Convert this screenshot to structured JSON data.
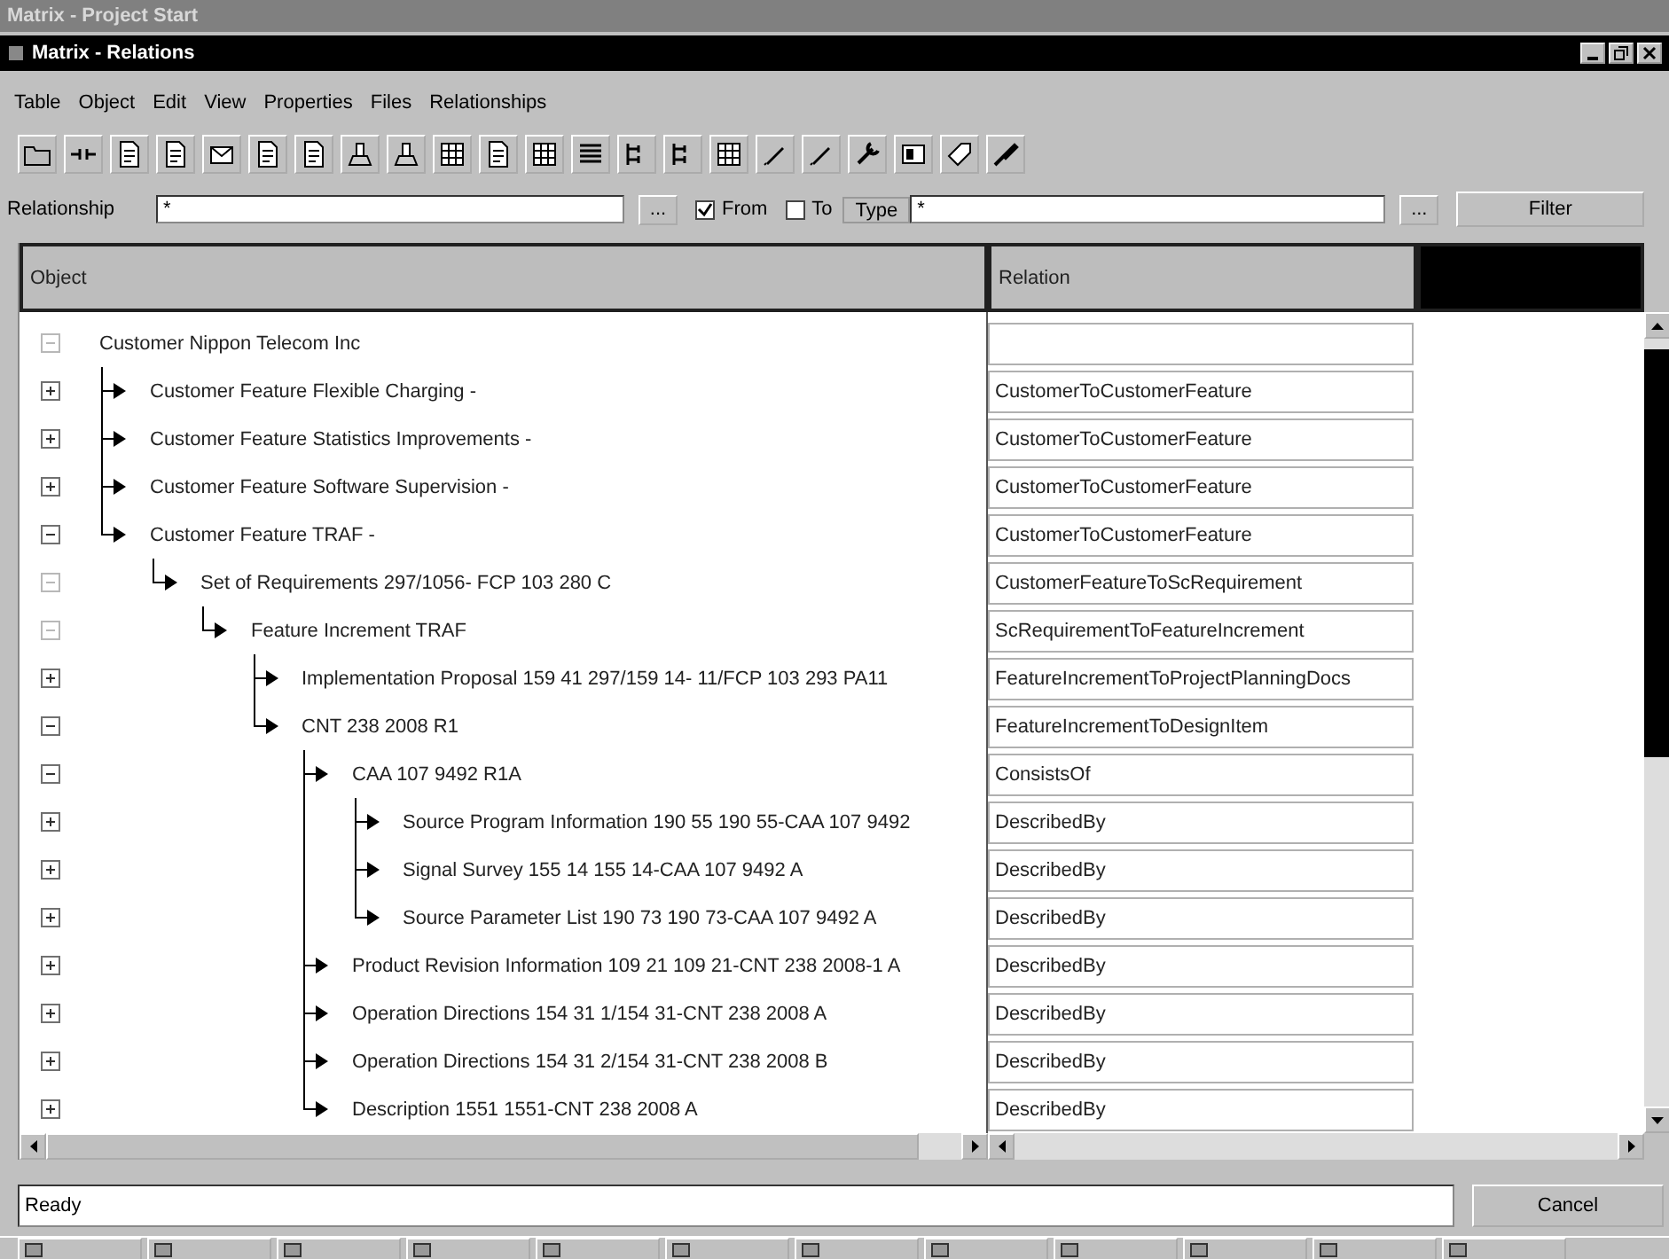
{
  "background_window": {
    "title": "Matrix - Project Start"
  },
  "window": {
    "title": "Matrix - Relations"
  },
  "menu": [
    "Table",
    "Object",
    "Edit",
    "View",
    "Properties",
    "Files",
    "Relationships"
  ],
  "filter": {
    "relationship_label": "Relationship",
    "relationship_value": "*",
    "browse_button": "...",
    "from": {
      "label": "From",
      "checked": true
    },
    "to": {
      "label": "To",
      "checked": false
    },
    "type_label": "Type",
    "type_value": "*",
    "type_browse_button": "...",
    "filter_button": "Filter"
  },
  "table": {
    "columns": [
      "Object",
      "Relation"
    ],
    "tree": [
      {
        "label": "Customer Nippon Telecom Inc",
        "expanded": true,
        "disabled": true,
        "children": [
          {
            "label": "Customer Feature Flexible Charging -",
            "relation": "CustomerToCustomerFeature",
            "expanded": false,
            "disabled": false
          },
          {
            "label": "Customer Feature Statistics Improvements -",
            "relation": "CustomerToCustomerFeature",
            "expanded": false,
            "disabled": false
          },
          {
            "label": "Customer Feature Software Supervision -",
            "relation": "CustomerToCustomerFeature",
            "expanded": false,
            "disabled": false
          },
          {
            "label": "Customer Feature TRAF -",
            "relation": "CustomerToCustomerFeature",
            "expanded": true,
            "disabled": false,
            "children": [
              {
                "label": "Set of Requirements 297/1056- FCP 103 280 C",
                "relation": "CustomerFeatureToScRequirement",
                "expanded": true,
                "disabled": true,
                "children": [
                  {
                    "label": "Feature Increment TRAF",
                    "relation": "ScRequirementToFeatureIncrement",
                    "expanded": true,
                    "disabled": true,
                    "children": [
                      {
                        "label": "Implementation Proposal 159 41 297/159 14- 11/FCP 103 293 PA11",
                        "relation": "FeatureIncrementToProjectPlanningDocs",
                        "expanded": false,
                        "disabled": false
                      },
                      {
                        "label": "CNT 238 2008 R1",
                        "relation": "FeatureIncrementToDesignItem",
                        "expanded": true,
                        "disabled": false,
                        "children": [
                          {
                            "label": "CAA 107 9492 R1A",
                            "relation": "ConsistsOf",
                            "expanded": true,
                            "disabled": false,
                            "children": [
                              {
                                "label": "Source Program Information 190 55 190 55-CAA 107 9492",
                                "relation": "DescribedBy",
                                "expanded": false,
                                "disabled": false
                              },
                              {
                                "label": "Signal Survey 155 14 155 14-CAA 107 9492 A",
                                "relation": "DescribedBy",
                                "expanded": false,
                                "disabled": false
                              },
                              {
                                "label": "Source Parameter List 190 73 190 73-CAA 107 9492 A",
                                "relation": "DescribedBy",
                                "expanded": false,
                                "disabled": false
                              }
                            ]
                          },
                          {
                            "label": "Product Revision Information 109 21 109 21-CNT 238 2008-1 A",
                            "relation": "DescribedBy",
                            "expanded": false,
                            "disabled": false
                          },
                          {
                            "label": "Operation Directions 154 31 1/154 31-CNT 238 2008 A",
                            "relation": "DescribedBy",
                            "expanded": false,
                            "disabled": false
                          },
                          {
                            "label": "Operation Directions 154 31 2/154 31-CNT 238 2008 B",
                            "relation": "DescribedBy",
                            "expanded": false,
                            "disabled": false
                          },
                          {
                            "label": "Description 1551 1551-CNT 238 2008 A",
                            "relation": "DescribedBy",
                            "expanded": false,
                            "disabled": false
                          }
                        ]
                      }
                    ]
                  }
                ]
              }
            ]
          }
        ]
      }
    ]
  },
  "status_bar": {
    "text": "Ready",
    "cancel_button": "Cancel"
  }
}
